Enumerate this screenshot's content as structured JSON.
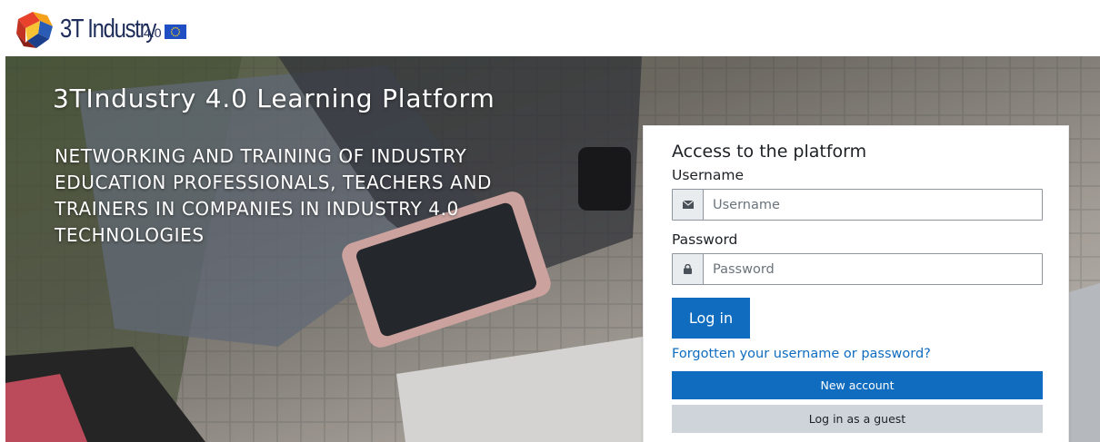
{
  "header": {
    "logo_text": "3T Industry",
    "logo_version": "4.0",
    "logo_icon": "cube-logo-icon",
    "flag_icon": "eu-flag-icon"
  },
  "hero": {
    "title": "3TIndustry 4.0 Learning Platform",
    "subtitle": "NETWORKING AND TRAINING OF INDUSTRY EDUCATION PROFESSIONALS, TEACHERS AND TRAINERS IN COMPANIES IN INDUSTRY 4.0 TECHNOLOGIES"
  },
  "login": {
    "title": "Access to the platform",
    "username_label": "Username",
    "username_placeholder": "Username",
    "username_value": "",
    "username_icon": "envelope-icon",
    "password_label": "Password",
    "password_placeholder": "Password",
    "password_value": "",
    "password_icon": "lock-icon",
    "login_button": "Log in",
    "forgot_link": "Forgotten your username or password?",
    "new_account_button": "New account",
    "guest_button": "Log in as a guest"
  },
  "colors": {
    "primary": "#0f6cbf",
    "secondary": "#ced4da",
    "text": "#1d2125"
  }
}
